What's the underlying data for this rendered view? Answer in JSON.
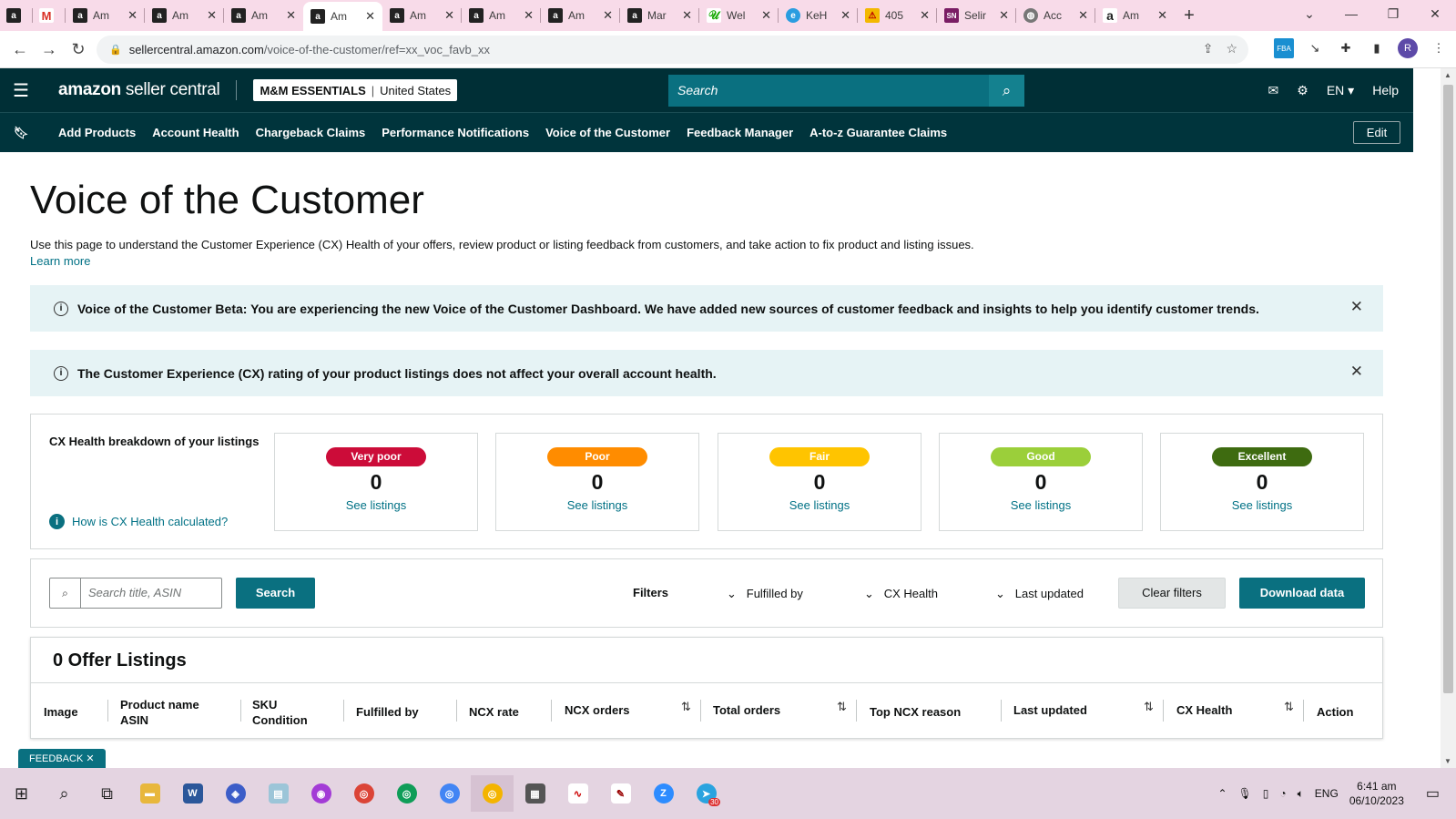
{
  "browser": {
    "tabs": [
      {
        "icon": "amazon-icon",
        "title": "",
        "active": false
      },
      {
        "icon": "gmail-icon",
        "title": "",
        "active": false
      },
      {
        "icon": "amazon-icon",
        "title": "Am",
        "active": false
      },
      {
        "icon": "amazon-icon",
        "title": "Am",
        "active": false
      },
      {
        "icon": "amazon-icon",
        "title": "Am",
        "active": false
      },
      {
        "icon": "amazon-icon",
        "title": "Am",
        "active": true
      },
      {
        "icon": "amazon-icon",
        "title": "Am",
        "active": false
      },
      {
        "icon": "amazon-icon",
        "title": "Am",
        "active": false
      },
      {
        "icon": "amazon-icon",
        "title": "Am",
        "active": false
      },
      {
        "icon": "amazon-icon",
        "title": "Mar",
        "active": false
      },
      {
        "icon": "upwork-icon",
        "title": "Wel",
        "active": false
      },
      {
        "icon": "edge-icon",
        "title": "KeH",
        "active": false
      },
      {
        "icon": "warning-icon",
        "title": "405",
        "active": false
      },
      {
        "icon": "sn-icon",
        "title": "Selir",
        "active": false
      },
      {
        "icon": "globe-icon",
        "title": "Acc",
        "active": false
      },
      {
        "icon": "amazon-icon",
        "title": "Am",
        "active": false
      }
    ],
    "url_host": "sellercentral.amazon.com",
    "url_path": "/voice-of-the-customer/ref=xx_voc_favb_xx",
    "profile_initial": "R"
  },
  "header": {
    "logo_bold": "amazon",
    "logo_rest": " seller central",
    "store_name": "M&M ESSENTIALS",
    "store_region": "United States",
    "search_placeholder": "Search",
    "language": "EN",
    "help": "Help"
  },
  "nav": {
    "items": [
      "Add Products",
      "Account Health",
      "Chargeback Claims",
      "Performance Notifications",
      "Voice of the Customer",
      "Feedback Manager",
      "A-to-z Guarantee Claims"
    ],
    "edit": "Edit"
  },
  "page": {
    "title": "Voice of the Customer",
    "intro": "Use this page to understand the Customer Experience (CX) Health of your offers, review product or listing feedback from customers, and take action to fix product and listing issues.",
    "learn_more": "Learn more",
    "alert1": "Voice of the Customer Beta: You are experiencing the new Voice of the Customer Dashboard. We have added new sources of customer feedback and insights to help you identify customer trends.",
    "alert2": "The Customer Experience (CX) rating of your product listings does not affect your overall account health."
  },
  "cx": {
    "label": "CX Health breakdown of your listings",
    "calc_link": "How is CX Health calculated?",
    "cards": [
      {
        "label": "Very poor",
        "count": "0",
        "link": "See listings",
        "color": "#cc0c39",
        "text_color": "#ffffff"
      },
      {
        "label": "Poor",
        "count": "0",
        "link": "See listings",
        "color": "#ff8c00",
        "text_color": "#ffffff"
      },
      {
        "label": "Fair",
        "count": "0",
        "link": "See listings",
        "color": "#ffc400",
        "text_color": "#ffffff"
      },
      {
        "label": "Good",
        "count": "0",
        "link": "See listings",
        "color": "#9bcf3a",
        "text_color": "#ffffff"
      },
      {
        "label": "Excellent",
        "count": "0",
        "link": "See listings",
        "color": "#3e6b10",
        "text_color": "#ffffff"
      }
    ]
  },
  "filters": {
    "search_placeholder": "Search title, ASIN",
    "search_button": "Search",
    "filters_label": "Filters",
    "fulfilled_by": "Fulfilled by",
    "cx_health": "CX Health",
    "last_updated": "Last updated",
    "clear": "Clear filters",
    "download": "Download data"
  },
  "listings": {
    "title": "0 Offer Listings",
    "columns": [
      "Image",
      "Product name",
      "ASIN",
      "SKU",
      "Condition",
      "Fulfilled by",
      "NCX rate",
      "NCX orders",
      "Total orders",
      "Top NCX reason",
      "Last updated",
      "CX Health",
      "Action"
    ]
  },
  "feedback_tab": "FEEDBACK",
  "taskbar": {
    "language": "ENG",
    "time": "6:41 am",
    "date": "06/10/2023",
    "telegram_badge": "30"
  },
  "colors": {
    "header_bg": "#002f36",
    "accent": "#0a7080",
    "link": "#007185",
    "alert_bg": "#e6f3f5"
  }
}
